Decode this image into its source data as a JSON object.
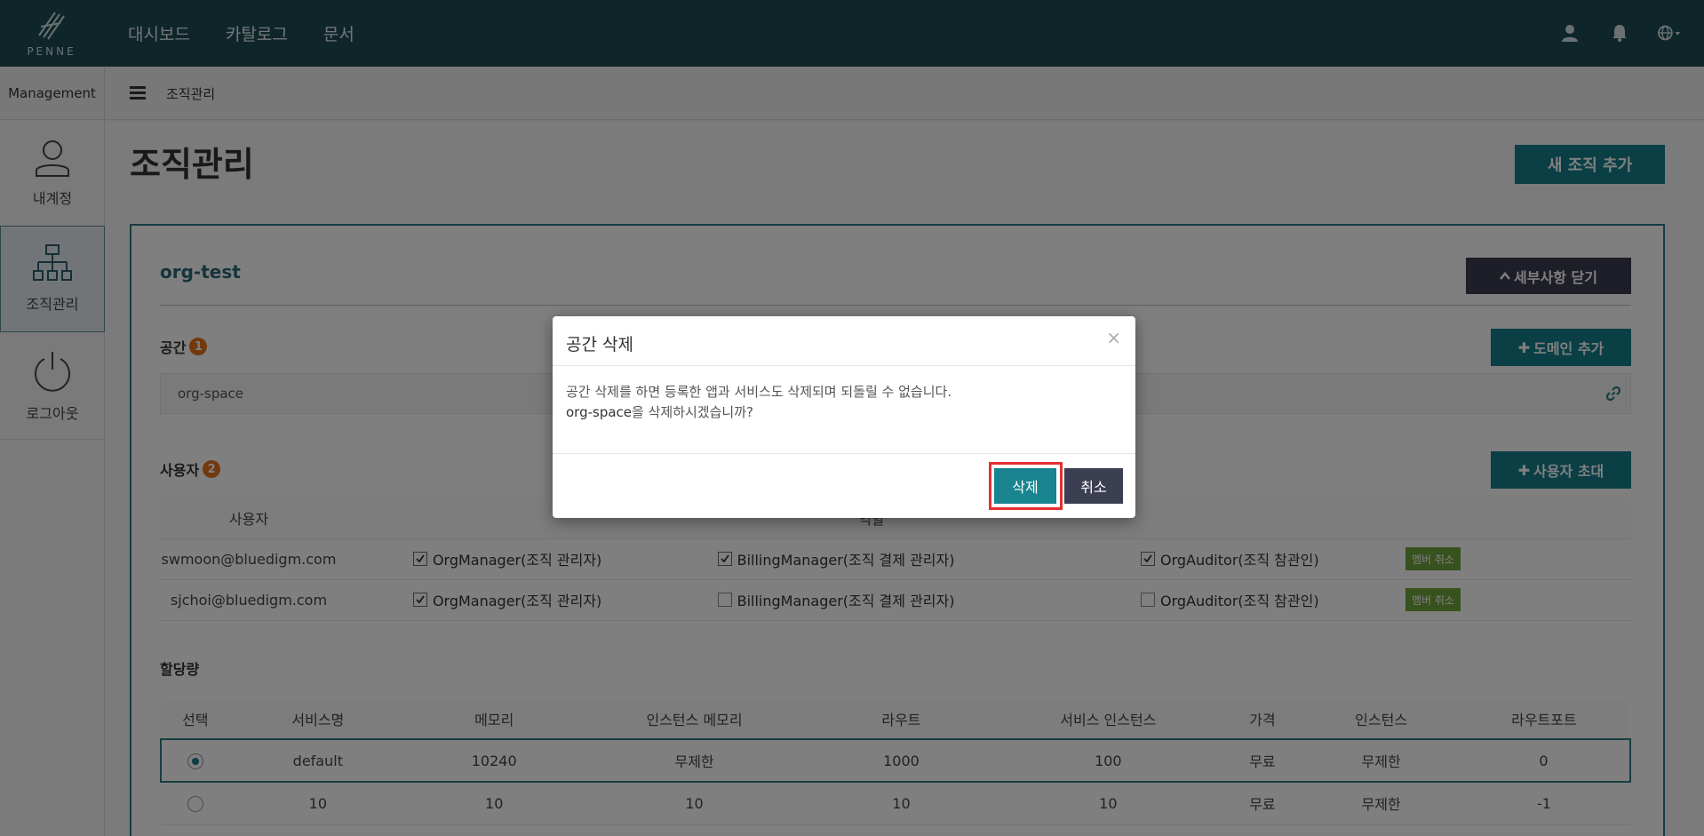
{
  "colors": {
    "navbar": "#1d4d55",
    "primary": "#157f8a",
    "dark_button": "#3a3d4e",
    "badge": "#e5731a",
    "member_cancel": "#71a53a",
    "focus_ring": "#e53030"
  },
  "navbar": {
    "logo_text": "PENNE",
    "links": [
      "대시보드",
      "카탈로그",
      "문서"
    ],
    "icons": [
      "user-icon",
      "bell-icon",
      "globe-icon"
    ]
  },
  "subheader": {
    "section": "Management",
    "breadcrumb": "조직관리"
  },
  "sidebar": {
    "items": [
      {
        "label": "내계정",
        "icon": "user-outline-icon"
      },
      {
        "label": "조직관리",
        "icon": "org-chart-icon"
      },
      {
        "label": "로그아웃",
        "icon": "power-icon"
      }
    ]
  },
  "main": {
    "title": "조직관리",
    "new_org_button": "새 조직 추가",
    "org": {
      "name": "org-test",
      "close_details_button": "세부사항 닫기",
      "spaces": {
        "label": "공간",
        "count": "1",
        "add_domain_button": "도메인 추가",
        "items": [
          "org-space"
        ]
      },
      "users": {
        "label": "사용자",
        "count": "2",
        "invite_button": "사용자 초대",
        "column_user": "사용자",
        "column_roles": "역할",
        "member_cancel_label": "멤버 취소",
        "rows": [
          {
            "email": "swmoon@bluedigm.com",
            "org_manager": "OrgManager(조직 관리자)",
            "billing_manager": "BillingManager(조직 결제 관리자)",
            "org_auditor": "OrgAuditor(조직 참관인)",
            "checked": [
              true,
              true,
              true
            ]
          },
          {
            "email": "sjchoi@bluedigm.com",
            "org_manager": "OrgManager(조직 관리자)",
            "billing_manager": "BillingManager(조직 결제 관리자)",
            "org_auditor": "OrgAuditor(조직 참관인)",
            "checked": [
              true,
              false,
              false
            ]
          }
        ]
      },
      "quota": {
        "label": "할당량",
        "columns": [
          "선택",
          "서비스명",
          "메모리",
          "인스턴스 메모리",
          "라우트",
          "서비스 인스턴스",
          "가격",
          "인스턴스",
          "라우트포트"
        ],
        "rows": [
          {
            "selected": true,
            "cells": [
              "default",
              "10240",
              "무제한",
              "1000",
              "100",
              "무료",
              "무제한",
              "0"
            ]
          },
          {
            "selected": false,
            "cells": [
              "10",
              "10",
              "10",
              "10",
              "10",
              "무료",
              "무제한",
              "-1"
            ]
          }
        ]
      }
    }
  },
  "modal": {
    "title": "공간 삭제",
    "line1": "공간 삭제를 하면 등록한 앱과 서비스도 삭제되며 되돌릴 수 없습니다.",
    "line2_space": "org-space",
    "line2_rest": "을 삭제하시겠습니까?",
    "delete_button": "삭제",
    "cancel_button": "취소"
  }
}
